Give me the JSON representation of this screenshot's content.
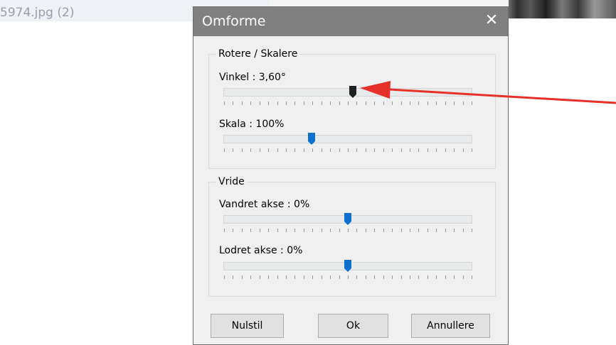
{
  "background": {
    "filename": "5974.jpg (2)"
  },
  "dialog": {
    "title": "Omforme",
    "close_glyph": "✕",
    "groups": [
      {
        "legend": "Rotere / Skalere",
        "sliders": [
          {
            "label": "Vinkel : 3,60°",
            "value_fraction": 0.52,
            "thumb_color": "#202020"
          },
          {
            "label": "Skala : 100%",
            "value_fraction": 0.355,
            "thumb_color": "#0f6fd0"
          }
        ]
      },
      {
        "legend": "Vride",
        "sliders": [
          {
            "label": "Vandret akse : 0%",
            "value_fraction": 0.5,
            "thumb_color": "#0f6fd0"
          },
          {
            "label": "Lodret akse : 0%",
            "value_fraction": 0.5,
            "thumb_color": "#0f6fd0"
          }
        ]
      }
    ],
    "buttons": {
      "reset": "Nulstil",
      "ok": "Ok",
      "cancel": "Annullere"
    }
  },
  "annotation": {
    "arrow_color": "#e8302a"
  }
}
